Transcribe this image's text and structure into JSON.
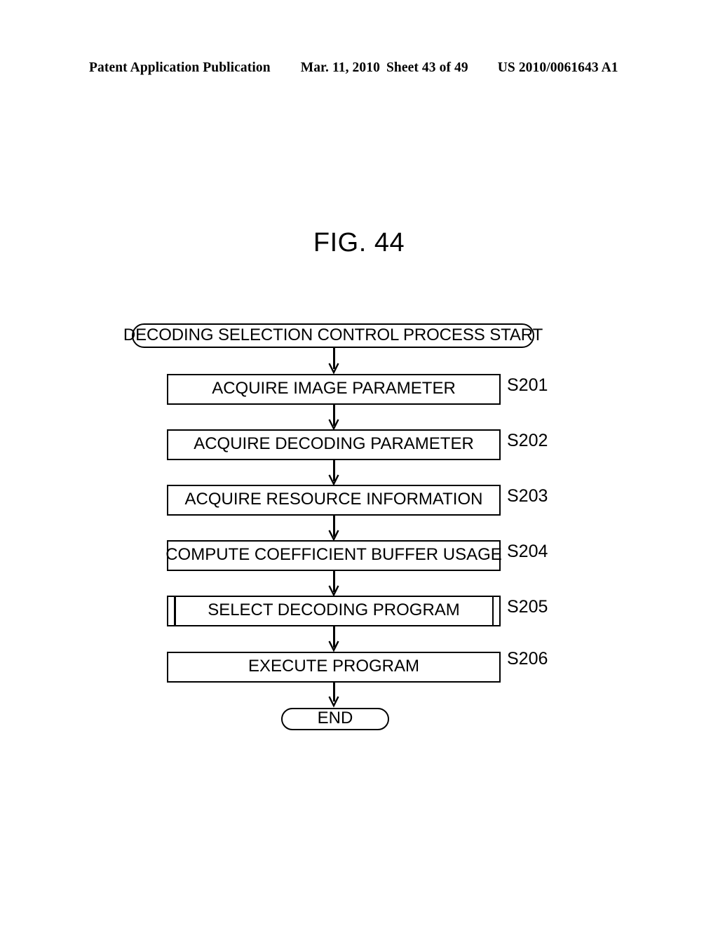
{
  "header": {
    "publication": "Patent Application Publication",
    "date": "Mar. 11, 2010",
    "sheet": "Sheet 43 of 49",
    "patent_number": "US 2010/0061643 A1"
  },
  "figure": {
    "title": "FIG. 44"
  },
  "flowchart": {
    "start": {
      "label": "DECODING SELECTION CONTROL PROCESS START",
      "shape": "terminator"
    },
    "end": {
      "label": "END",
      "shape": "terminator"
    },
    "steps": [
      {
        "step": "S201",
        "label": "ACQUIRE IMAGE PARAMETER",
        "shape": "process"
      },
      {
        "step": "S202",
        "label": "ACQUIRE DECODING PARAMETER",
        "shape": "process"
      },
      {
        "step": "S203",
        "label": "ACQUIRE RESOURCE INFORMATION",
        "shape": "process"
      },
      {
        "step": "S204",
        "label": "COMPUTE COEFFICIENT BUFFER USAGE",
        "shape": "process"
      },
      {
        "step": "S205",
        "label": "SELECT DECODING PROGRAM",
        "shape": "predefined-process"
      },
      {
        "step": "S206",
        "label": "EXECUTE PROGRAM",
        "shape": "process"
      }
    ]
  },
  "colors": {
    "ink": "#000000",
    "page": "#ffffff"
  }
}
